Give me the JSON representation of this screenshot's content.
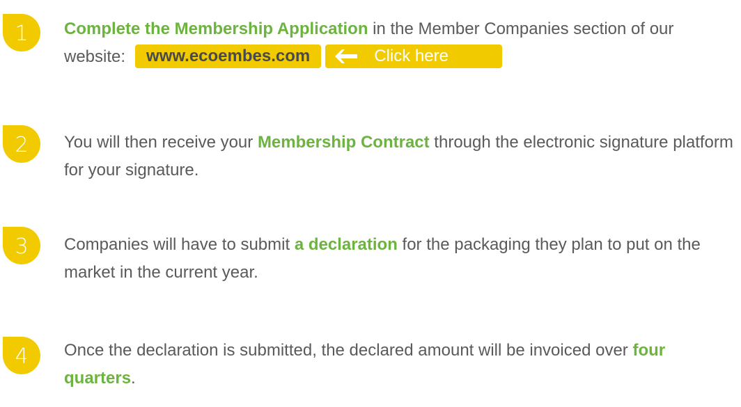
{
  "steps": [
    {
      "number": "1",
      "emphasis": "Complete the Membership Application",
      "text_after": " in the Member Companies section of our website:",
      "url": "www.ecoembes.com",
      "click_label": "Click here"
    },
    {
      "number": "2",
      "text_before": "You will then receive your ",
      "emphasis": "Membership Contract",
      "text_after": " through the electronic signature platform for your signature."
    },
    {
      "number": "3",
      "text_before": "Companies will have to submit ",
      "emphasis": "a declaration",
      "text_after": " for the packaging they plan to put on the market in the current year."
    },
    {
      "number": "4",
      "text_before": "Once the declaration is submitted, the declared amount will be invoiced over ",
      "emphasis": "four quarters",
      "text_after": "."
    }
  ],
  "colors": {
    "badge": "#f1cb00",
    "emphasis": "#6cb33f",
    "body_text": "#5a5a5a"
  },
  "icons": {
    "link_arrow": "arrow-left-icon"
  }
}
